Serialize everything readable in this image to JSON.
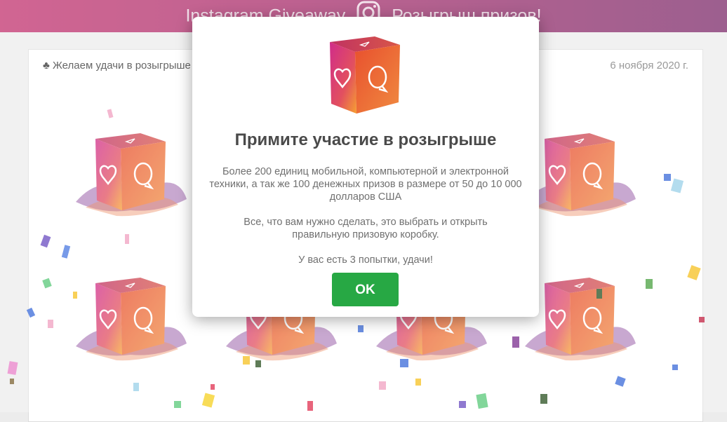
{
  "header": {
    "title_left": "Instagram Giveaway",
    "title_right": "Розыгрыш призов!",
    "icon": "instagram-icon"
  },
  "panel": {
    "greeting": "Желаем удачи в розыгрыше",
    "greeting_icon": "club-icon",
    "date": "6 ноября 2020 г."
  },
  "modal": {
    "title": "Примите участие в розыгрыше",
    "paragraph1": "Более 200 единиц мобильной, компьютерной и электронной техники, а так же 100 денежных призов в размере от 50 до 10 000 долларов США",
    "paragraph2": "Все, что вам нужно сделать, это выбрать и открыть правильную призовую коробку.",
    "paragraph3": "У вас есть 3 попытки, удачи!",
    "ok_label": "OK",
    "icon": "gift-box-icon"
  },
  "colors": {
    "header_gradient_start": "#c2326e",
    "header_gradient_end": "#7c2a6a",
    "ok_button": "#27a844",
    "box_pink": "#e0407a",
    "box_orange": "#f07a35"
  }
}
